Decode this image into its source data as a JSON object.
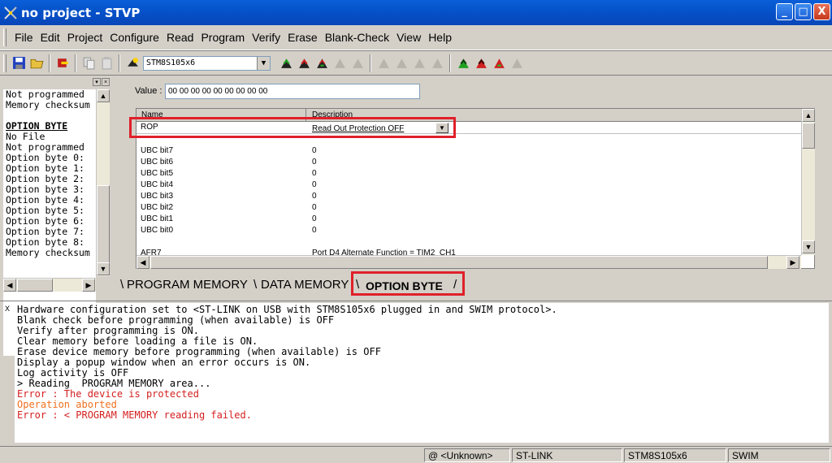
{
  "window": {
    "title": "no project - STVP",
    "minimize": "_",
    "maximize": "□",
    "close": "X"
  },
  "menu": [
    "File",
    "Edit",
    "Project",
    "Configure",
    "Read",
    "Program",
    "Verify",
    "Erase",
    "Blank-Check",
    "View",
    "Help"
  ],
  "toolbar": {
    "device": "STM8S105x6"
  },
  "left_panel": {
    "lines": [
      {
        "text": "Not programmed",
        "type": "normal"
      },
      {
        "text": "Memory checksum",
        "type": "normal"
      },
      {
        "text": "OPTION BYTE",
        "type": "head"
      },
      {
        "text": "No File",
        "type": "normal"
      },
      {
        "text": "Not programmed",
        "type": "normal"
      },
      {
        "text": "Option byte 0:",
        "type": "normal"
      },
      {
        "text": "Option byte 1:",
        "type": "normal"
      },
      {
        "text": "Option byte 2:",
        "type": "normal"
      },
      {
        "text": "Option byte 3:",
        "type": "normal"
      },
      {
        "text": "Option byte 4:",
        "type": "normal"
      },
      {
        "text": "Option byte 5:",
        "type": "normal"
      },
      {
        "text": "Option byte 6:",
        "type": "normal"
      },
      {
        "text": "Option byte 7:",
        "type": "normal"
      },
      {
        "text": "Option byte 8:",
        "type": "normal"
      },
      {
        "text": "Memory checksum",
        "type": "normal"
      }
    ]
  },
  "value_field": {
    "label": "Value :",
    "value": "00 00 00 00 00 00 00 00 00"
  },
  "grid": {
    "col_name": "Name",
    "col_description": "Description",
    "rop": {
      "name": "ROP",
      "description": "Read Out Protection OFF"
    },
    "rows": [
      {
        "name": "UBC bit7",
        "value": "0"
      },
      {
        "name": "UBC bit6",
        "value": "0"
      },
      {
        "name": "UBC bit5",
        "value": "0"
      },
      {
        "name": "UBC bit4",
        "value": "0"
      },
      {
        "name": "UBC bit3",
        "value": "0"
      },
      {
        "name": "UBC bit2",
        "value": "0"
      },
      {
        "name": "UBC bit1",
        "value": "0"
      },
      {
        "name": "UBC bit0",
        "value": "0"
      }
    ],
    "partial_row": {
      "name": "AFR7",
      "value": "Port D4 Alternate Function = TIM2_CH1"
    }
  },
  "tabs": [
    "PROGRAM MEMORY",
    "DATA MEMORY",
    "OPTION BYTE"
  ],
  "log": {
    "close": "X",
    "lines": [
      {
        "text": "Hardware configuration set to <ST-LINK on USB with STM8S105x6 plugged in and SWIM protocol>.",
        "type": "normal"
      },
      {
        "text": "Blank check before programming (when available) is OFF",
        "type": "normal"
      },
      {
        "text": "Verify after programming is ON.",
        "type": "normal"
      },
      {
        "text": "Clear memory before loading a file is ON.",
        "type": "normal"
      },
      {
        "text": "Erase device memory before programming (when available) is OFF",
        "type": "normal"
      },
      {
        "text": "Display a popup window when an error occurs is ON.",
        "type": "normal"
      },
      {
        "text": "Log activity is OFF",
        "type": "normal"
      },
      {
        "text": "> Reading  PROGRAM MEMORY area...",
        "type": "normal"
      },
      {
        "text": "Error : The device is protected",
        "type": "err"
      },
      {
        "text": "Operation aborted",
        "type": "warn"
      },
      {
        "text": "Error : < PROGRAM MEMORY reading failed.",
        "type": "err"
      }
    ]
  },
  "statusbar": {
    "address": "@ <Unknown>",
    "tool": "ST-LINK",
    "device": "STM8S105x6",
    "protocol": "SWIM"
  },
  "colors": {
    "highlight": "#e0202a",
    "error": "#d42020",
    "warning": "#f07020"
  }
}
